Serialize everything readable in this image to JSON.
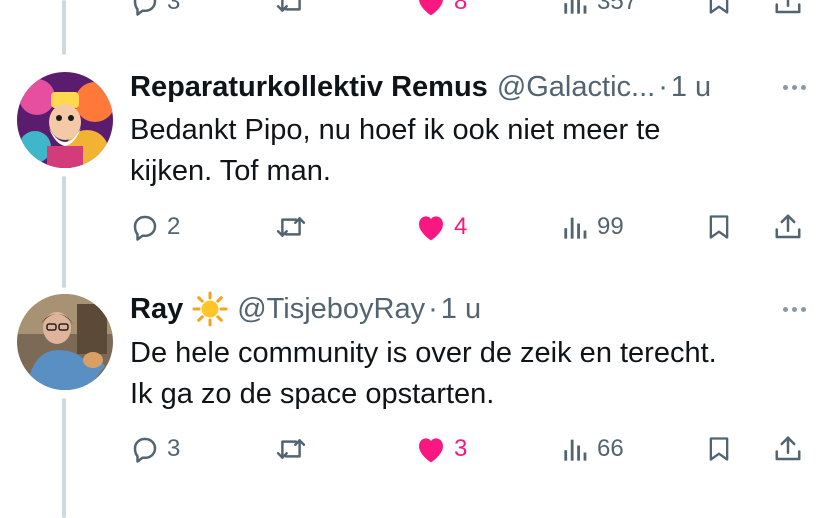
{
  "top_tweet": {
    "replies": "3",
    "likes": "8",
    "views": "357"
  },
  "tweets": [
    {
      "name": "Reparaturkollektiv Remus",
      "handle": "@Galactic...",
      "separator": "·",
      "time": "1 u",
      "text_lines": [
        "Bedankt Pipo, nu hoef ik ook niet meer te",
        "kijken. Tof man."
      ],
      "replies": "2",
      "likes": "4",
      "views": "99",
      "liked": true
    },
    {
      "name": "Ray",
      "name_emoji": "sun-icon",
      "handle": "@TisjeboyRay",
      "separator": "·",
      "time": "1 u",
      "text_lines": [
        "De hele community is over de zeik en terecht.",
        "Ik ga zo de space opstarten."
      ],
      "replies": "3",
      "likes": "3",
      "views": "66",
      "liked": true
    }
  ],
  "colors": {
    "like": "#f91880",
    "secondary_text": "#536471",
    "thread_line": "#cfd9de"
  }
}
